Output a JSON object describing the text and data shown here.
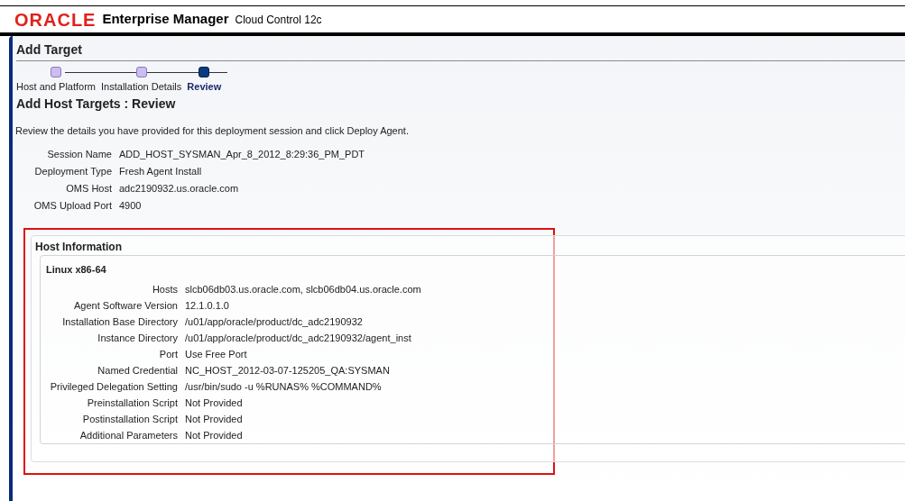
{
  "header": {
    "logo": "ORACLE",
    "product": "Enterprise Manager",
    "edition": "Cloud Control 12c"
  },
  "page_title": "Add Target",
  "train": [
    {
      "label": "Host and Platform",
      "selected": false
    },
    {
      "label": "Installation Details",
      "selected": false
    },
    {
      "label": "Review",
      "selected": true
    }
  ],
  "heading": "Add Host Targets : Review",
  "instruction": "Review the details you have provided for this deployment session and click Deploy Agent.",
  "fields": [
    {
      "label": "Session Name",
      "value": "ADD_HOST_SYSMAN_Apr_8_2012_8:29:36_PM_PDT"
    },
    {
      "label": "Deployment Type",
      "value": "Fresh Agent Install"
    },
    {
      "label": "OMS Host",
      "value": "adc2190932.us.oracle.com"
    },
    {
      "label": "OMS Upload Port",
      "value": "4900"
    }
  ],
  "host_information": {
    "title": "Host Information",
    "platform": "Linux x86-64",
    "rows": [
      {
        "label": "Hosts",
        "value": "slcb06db03.us.oracle.com, slcb06db04.us.oracle.com"
      },
      {
        "label": "Agent Software Version",
        "value": "12.1.0.1.0"
      },
      {
        "label": "Installation Base Directory",
        "value": "/u01/app/oracle/product/dc_adc2190932"
      },
      {
        "label": "Instance Directory",
        "value": "/u01/app/oracle/product/dc_adc2190932/agent_inst"
      },
      {
        "label": "Port",
        "value": "Use Free Port"
      },
      {
        "label": "Named Credential",
        "value": "NC_HOST_2012-03-07-125205_QA:SYSMAN"
      },
      {
        "label": "Privileged Delegation Setting",
        "value": "/usr/bin/sudo -u %RUNAS% %COMMAND%"
      },
      {
        "label": "Preinstallation Script",
        "value": "Not Provided"
      },
      {
        "label": "Postinstallation Script",
        "value": "Not Provided"
      },
      {
        "label": "Additional Parameters",
        "value": "Not Provided"
      }
    ]
  }
}
